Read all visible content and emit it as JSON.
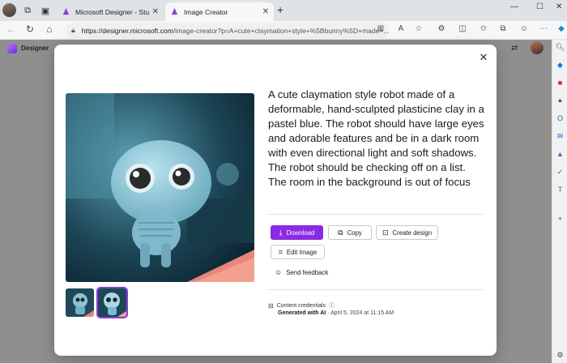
{
  "browser": {
    "tabs": [
      {
        "title": "Microsoft Designer - Stunning designs",
        "active": false
      },
      {
        "title": "Image Creator",
        "active": true
      }
    ],
    "url_host": "https://designer.microsoft.com",
    "url_path": "/image-creator?p=A+cute+claymation+style+%5Bbunny%5D+made+..."
  },
  "page": {
    "brand": "Designer"
  },
  "modal": {
    "prompt": "A cute claymation style robot made of a deformable, hand-sculpted plasticine clay in a pastel blue. The robot should have large eyes and adorable features and be in a dark room with even directional light and soft shadows. The robot should be checking off on a list. The room in the background is out of focus",
    "buttons": {
      "download": "Download",
      "copy": "Copy",
      "create_design": "Create design",
      "edit_image": "Edit Image",
      "send_feedback": "Send feedback"
    },
    "credentials": {
      "label": "Content credentials",
      "generated_with": "Generated with AI",
      "date": " · April 5, 2024 at 11:15 AM"
    }
  },
  "colors": {
    "accent": "#8a2be2",
    "overlay": "#8f8f8f"
  }
}
